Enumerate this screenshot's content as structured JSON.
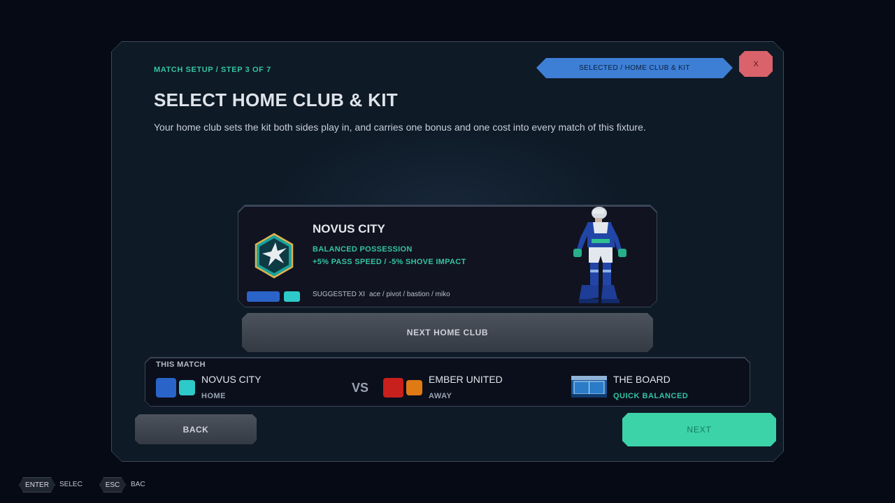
{
  "header": {
    "breadcrumb": "MATCH SETUP  /  STEP 3 OF 7",
    "title": "SELECT HOME CLUB & KIT",
    "subtitle": "Your home club sets the kit both sides play in, and carries one bonus and one cost into every match of this fixture.",
    "selected_label": "SELECTED  /  HOME CLUB & KIT",
    "close_label": "X"
  },
  "club": {
    "name": "NOVUS CITY",
    "style": "BALANCED POSSESSION",
    "modifiers": "+5% PASS SPEED  /  -5% SHOVE IMPACT",
    "suggested_label": "SUGGESTED XI",
    "suggested_names": "ace  /  pivot  /  bastion  /  miko",
    "kit_colors": [
      "#2a64c8",
      "#2ec9c9"
    ],
    "crest_icon": "star-crest-icon",
    "player_icon": "player-kit-preview"
  },
  "next_club_label": "NEXT HOME CLUB",
  "match": {
    "label": "THIS MATCH",
    "home": {
      "name": "NOVUS CITY",
      "role": "HOME",
      "colors": [
        "#2a64c8",
        "#2ec9c9"
      ]
    },
    "vs": "VS",
    "away": {
      "name": "EMBER UNITED",
      "role": "AWAY",
      "colors": [
        "#c8201c",
        "#e07a14"
      ]
    },
    "venue": {
      "name": "THE BOARD",
      "mode": "QUICK BALANCED"
    }
  },
  "actions": {
    "back_label": "BACK",
    "next_label": "NEXT"
  },
  "hints": [
    {
      "key": "ENTER",
      "text": "SELEC"
    },
    {
      "key": "ESC",
      "text": "BAC"
    }
  ],
  "colors": {
    "accent": "#34c3a4",
    "next_button": "#3cd3a8",
    "selected_pill": "#3e7fd6",
    "close_button": "#d9626b"
  }
}
